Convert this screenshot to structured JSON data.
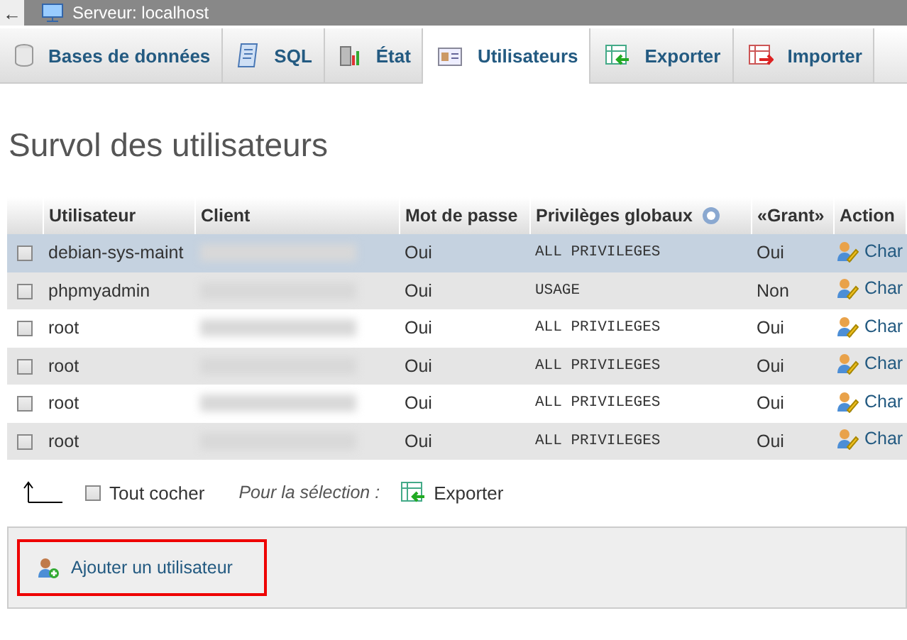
{
  "window": {
    "back": "←",
    "title": "Serveur: localhost"
  },
  "tabs": [
    {
      "label": "Bases de données",
      "selected": false
    },
    {
      "label": "SQL",
      "selected": false
    },
    {
      "label": "État",
      "selected": false
    },
    {
      "label": "Utilisateurs",
      "selected": true
    },
    {
      "label": "Exporter",
      "selected": false
    },
    {
      "label": "Importer",
      "selected": false
    }
  ],
  "heading": "Survol des utilisateurs",
  "table": {
    "columns": [
      "Utilisateur",
      "Client",
      "Mot de passe",
      "Privilèges globaux",
      "«Grant»",
      "Action"
    ],
    "rows": [
      {
        "user": "debian-sys-maint",
        "password": "Oui",
        "privileges": "ALL PRIVILEGES",
        "grant": "Oui",
        "action": "Char",
        "selected": true,
        "checked": false
      },
      {
        "user": "phpmyadmin",
        "password": "Oui",
        "privileges": "USAGE",
        "grant": "Non",
        "action": "Char",
        "selected": false,
        "checked": false
      },
      {
        "user": "root",
        "password": "Oui",
        "privileges": "ALL PRIVILEGES",
        "grant": "Oui",
        "action": "Char",
        "selected": false,
        "checked": false
      },
      {
        "user": "root",
        "password": "Oui",
        "privileges": "ALL PRIVILEGES",
        "grant": "Oui",
        "action": "Char",
        "selected": false,
        "checked": false
      },
      {
        "user": "root",
        "password": "Oui",
        "privileges": "ALL PRIVILEGES",
        "grant": "Oui",
        "action": "Char",
        "selected": false,
        "checked": false
      },
      {
        "user": "root",
        "password": "Oui",
        "privileges": "ALL PRIVILEGES",
        "grant": "Oui",
        "action": "Char",
        "selected": false,
        "checked": false
      }
    ]
  },
  "bulk": {
    "check_all": {
      "label": "Tout cocher",
      "checked": false
    },
    "for_selection": "Pour la sélection :",
    "export": "Exporter"
  },
  "add_user": "Ajouter un utilisateur"
}
